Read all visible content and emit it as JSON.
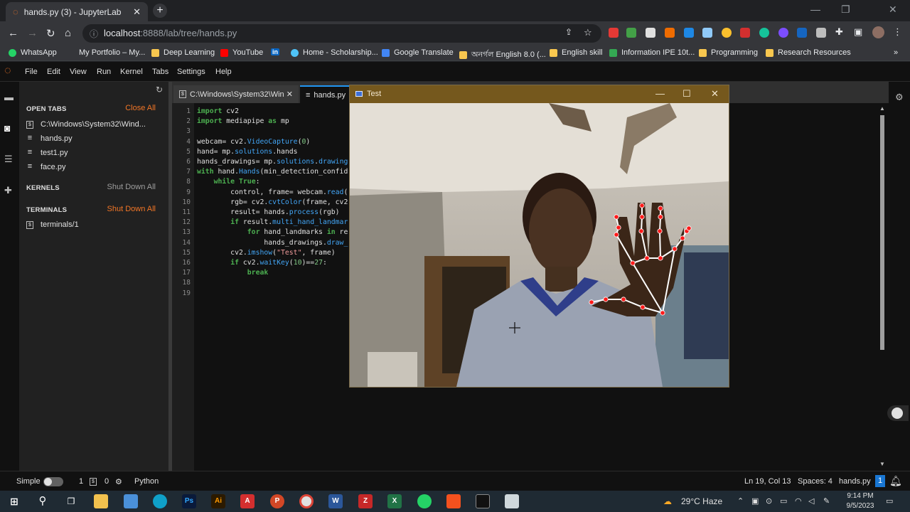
{
  "browser": {
    "tab_title": "hands.py (3) - JupyterLab",
    "new_tab": "+",
    "url_host": "localhost",
    "url_rest": ":8888/lab/tree/hands.py"
  },
  "bookmarks": [
    {
      "label": "WhatsApp",
      "color": "#25d366"
    },
    {
      "label": "My Portfolio – My...",
      "color": ""
    },
    {
      "label": "Deep Learning",
      "color": "#f9c74f"
    },
    {
      "label": "YouTube",
      "color": "#ff0000"
    },
    {
      "label": "in",
      "color": "#0a66c2"
    },
    {
      "label": "Home - Scholarship...",
      "color": "#4fc3f7"
    },
    {
      "label": "Google Translate",
      "color": "#4285f4"
    },
    {
      "label": "অনর্গল English 8.0 (...",
      "color": "#f9c74f"
    },
    {
      "label": "English skill",
      "color": "#f9c74f"
    },
    {
      "label": "Information IPE 10t...",
      "color": "#34a853"
    },
    {
      "label": "Programming",
      "color": "#f9c74f"
    },
    {
      "label": "Research Resources",
      "color": "#f9c74f"
    }
  ],
  "menu": [
    "File",
    "Edit",
    "View",
    "Run",
    "Kernel",
    "Tabs",
    "Settings",
    "Help"
  ],
  "panel": {
    "open_tabs": "OPEN TABS",
    "close_all": "Close All",
    "files": [
      "C:\\Windows\\System32\\Wind...",
      "hands.py",
      "test1.py",
      "face.py"
    ],
    "kernels": "KERNELS",
    "kernels_action": "Shut Down All",
    "terminals": "TERMINALS",
    "terminals_action": "Shut Down All",
    "terminal_items": [
      "terminals/1"
    ]
  },
  "editor_tabs": [
    "C:\\Windows\\System32\\Wind",
    "hands.py"
  ],
  "code_lines": [
    "import cv2",
    "import mediapipe as mp",
    "",
    "webcam= cv2.VideoCapture(0)",
    "hand= mp.solutions.hands",
    "hands_drawings= mp.solutions.drawing",
    "with hand.Hands(min_detection_confid",
    "    while True:",
    "        control, frame= webcam.read(",
    "        rgb= cv2.cvtColor(frame, cv2",
    "        result= hands.process(rgb)",
    "        if result.multi_hand_landmar",
    "            for hand_landmarks in re",
    "                hands_drawings.draw_",
    "        cv2.imshow(\"Test\", frame)",
    "        if cv2.waitKey(10)==27:",
    "            break",
    "",
    ""
  ],
  "line_numbers": [
    "1",
    "2",
    "3",
    "4",
    "5",
    "6",
    "7",
    "8",
    "9",
    "10",
    "11",
    "12",
    "13",
    "14",
    "15",
    "16",
    "17",
    "18",
    "19"
  ],
  "cv_window": {
    "title": "Test"
  },
  "status": {
    "mode": "Simple",
    "count1": "1",
    "count2": "0",
    "language": "Python",
    "position": "Ln 19, Col 13",
    "spaces": "Spaces: 4",
    "file": "hands.py",
    "badge": "1"
  },
  "taskbar": {
    "weather": "29°C  Haze",
    "time": "9:14 PM",
    "date": "9/5/2023"
  }
}
